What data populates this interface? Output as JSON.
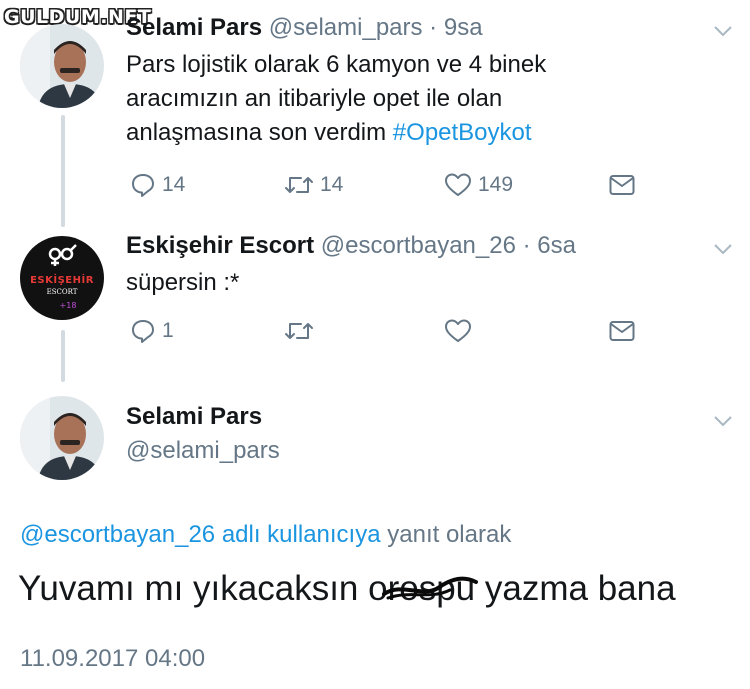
{
  "watermark": {
    "text": "GULDUM.NET"
  },
  "tweets": [
    {
      "name": "Selami Pars",
      "handle": "@selami_pars",
      "time": "9sa",
      "text_lines": [
        "Pars lojistik olarak 6  kamyon ve 4 binek",
        "aracımızın an itibariyle opet ile olan",
        "anlaşmasına son verdim "
      ],
      "hashtag": "#OpetBoykot",
      "replies": "14",
      "retweets": "14",
      "likes": "149"
    },
    {
      "name": "Eskişehir Escort",
      "handle": "@escortbayan_26",
      "time": "6sa",
      "text": "süpersin :*",
      "avatar_title": "ESKİŞEHİR",
      "avatar_sub": "ESCORT",
      "avatar_badge": "+18",
      "replies": "1"
    }
  ],
  "focused": {
    "name": "Selami Pars",
    "handle": "@selami_pars",
    "reply_to_mention": "@escortbayan_26 adlı kullanıcıya",
    "reply_to_suffix": " yanıt olarak",
    "text_before": "Yuvamı mı yıkacaksın ",
    "text_censored": "orospu",
    "text_after": " yazma bana",
    "timestamp": "11.09.2017 04:00"
  },
  "colors": {
    "link": "#1b95e0",
    "muted": "#657786",
    "text": "#14171a",
    "thread_line": "#d3dbe1"
  },
  "icons": [
    "reply-icon",
    "retweet-icon",
    "like-icon",
    "message-icon",
    "chevron-down-icon"
  ]
}
